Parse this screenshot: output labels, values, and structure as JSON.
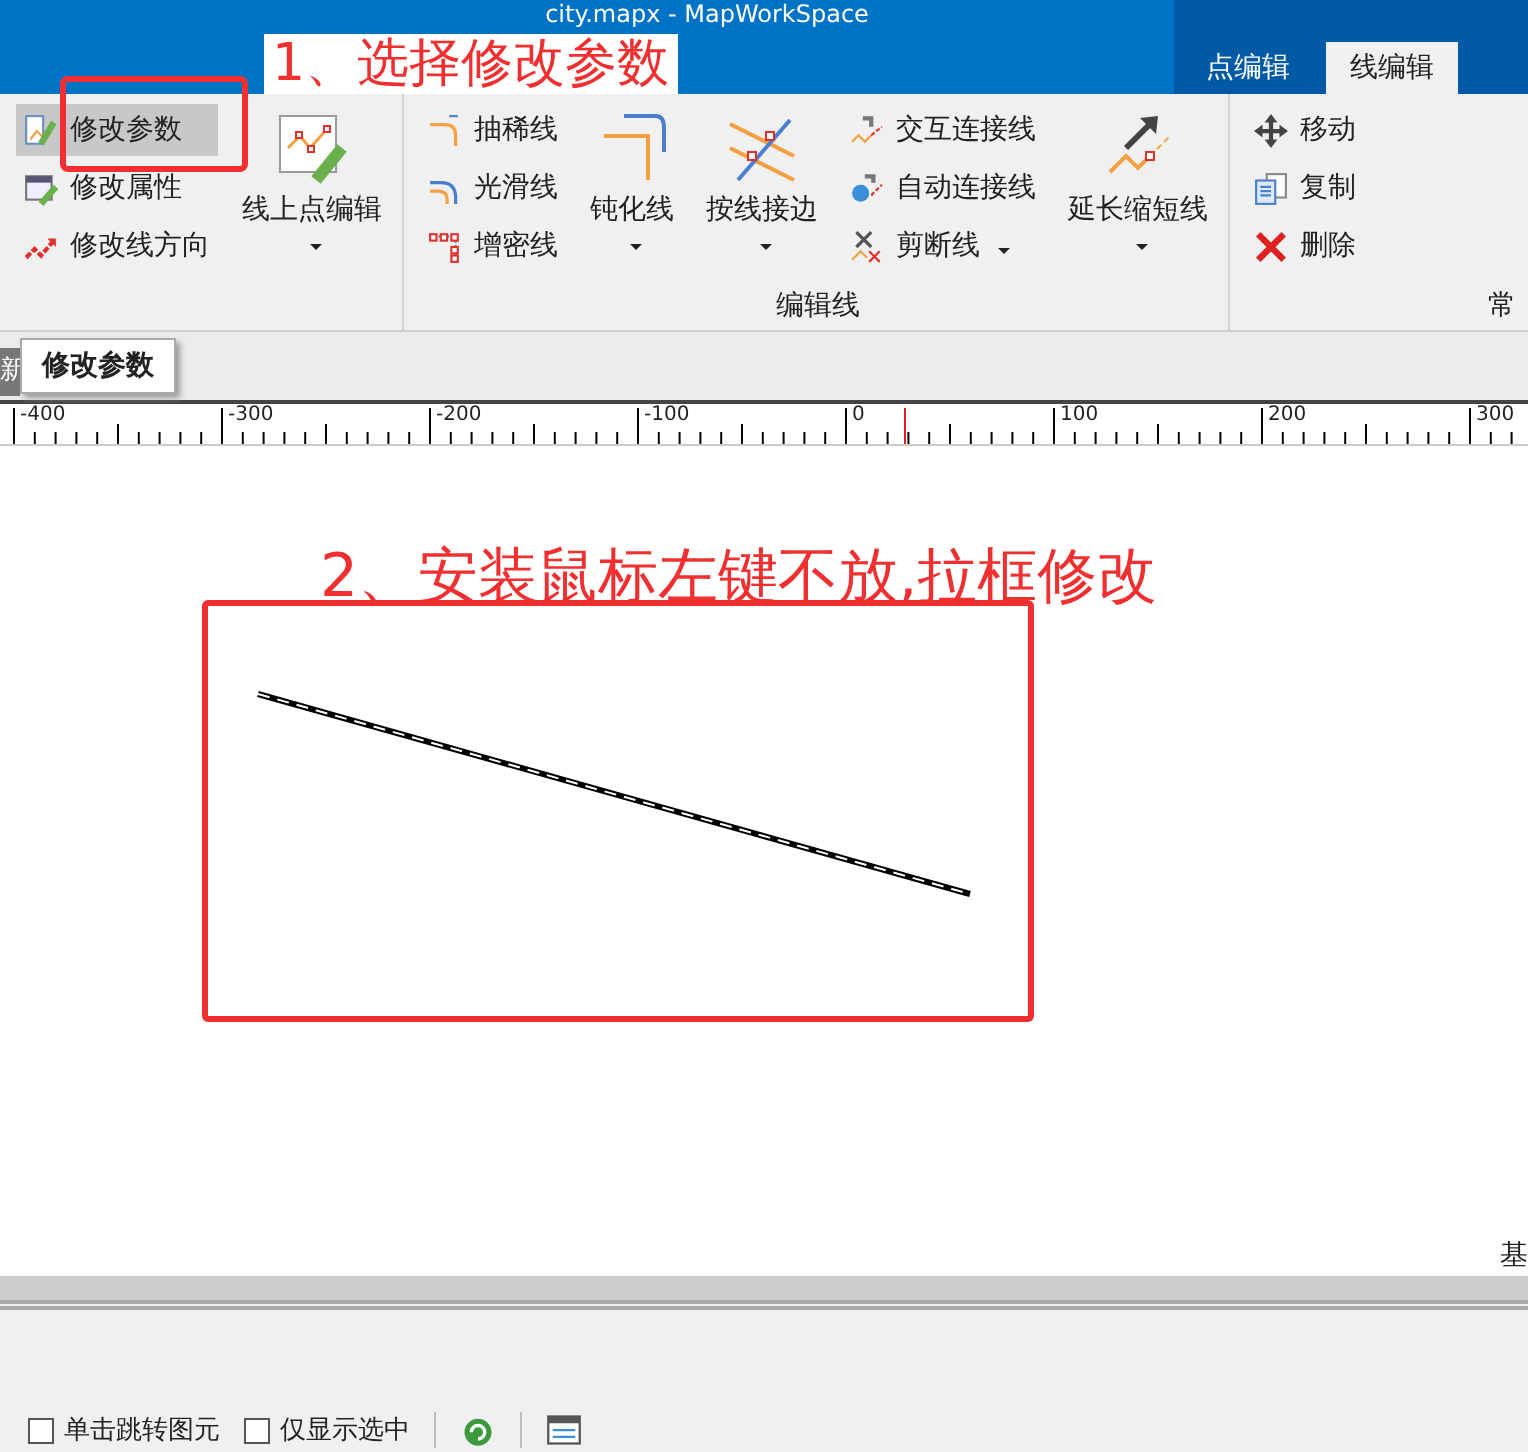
{
  "window": {
    "title": "city.mapx - MapWorkSpace"
  },
  "ribbon_tabs": [
    {
      "label": "点编辑",
      "selected": false
    },
    {
      "label": "线编辑",
      "selected": true
    }
  ],
  "ribbon_groups": [
    {
      "columns": [
        {
          "kind": "small",
          "items": [
            {
              "label": "修改参数",
              "selected": true,
              "dropdown": false
            },
            {
              "label": "修改属性",
              "selected": false,
              "dropdown": false
            },
            {
              "label": "修改线方向",
              "selected": false,
              "dropdown": false
            }
          ]
        },
        {
          "kind": "large",
          "label": "线上点编辑",
          "dropdown": true
        }
      ]
    },
    {
      "label": "编辑线",
      "columns": [
        {
          "kind": "small",
          "items": [
            {
              "label": "抽稀线",
              "selected": false,
              "dropdown": false
            },
            {
              "label": "光滑线",
              "selected": false,
              "dropdown": false
            },
            {
              "label": "增密线",
              "selected": false,
              "dropdown": false
            }
          ]
        },
        {
          "kind": "large",
          "label": "钝化线",
          "dropdown": true
        },
        {
          "kind": "large",
          "label": "按线接边",
          "dropdown": true
        },
        {
          "kind": "small",
          "items": [
            {
              "label": "交互连接线",
              "selected": false,
              "dropdown": false
            },
            {
              "label": "自动连接线",
              "selected": false,
              "dropdown": false
            },
            {
              "label": "剪断线",
              "selected": false,
              "dropdown": true
            }
          ]
        },
        {
          "kind": "large",
          "label": "延长缩短线",
          "dropdown": true
        }
      ]
    },
    {
      "label": "常",
      "columns": [
        {
          "kind": "small",
          "items": [
            {
              "label": "移动",
              "selected": false,
              "dropdown": false
            },
            {
              "label": "复制",
              "selected": false,
              "dropdown": false
            },
            {
              "label": "删除",
              "selected": false,
              "dropdown": false
            }
          ]
        }
      ]
    }
  ],
  "doc_tab": {
    "label": "新"
  },
  "tooltip": {
    "text": "修改参数"
  },
  "ruler": {
    "labels": [
      "-400",
      "-300",
      "-200",
      "-100",
      "0",
      "100",
      "200",
      "300"
    ]
  },
  "annotations": [
    {
      "text": "1、选择修改参数"
    },
    {
      "text": "2、安装鼠标左键不放,拉框修改"
    }
  ],
  "canvas_corner": {
    "text": "基"
  },
  "bottom_panel": {
    "checkboxes": [
      {
        "label": "单击跳转图元",
        "checked": false
      },
      {
        "label": "仅显示选中",
        "checked": false
      }
    ]
  }
}
